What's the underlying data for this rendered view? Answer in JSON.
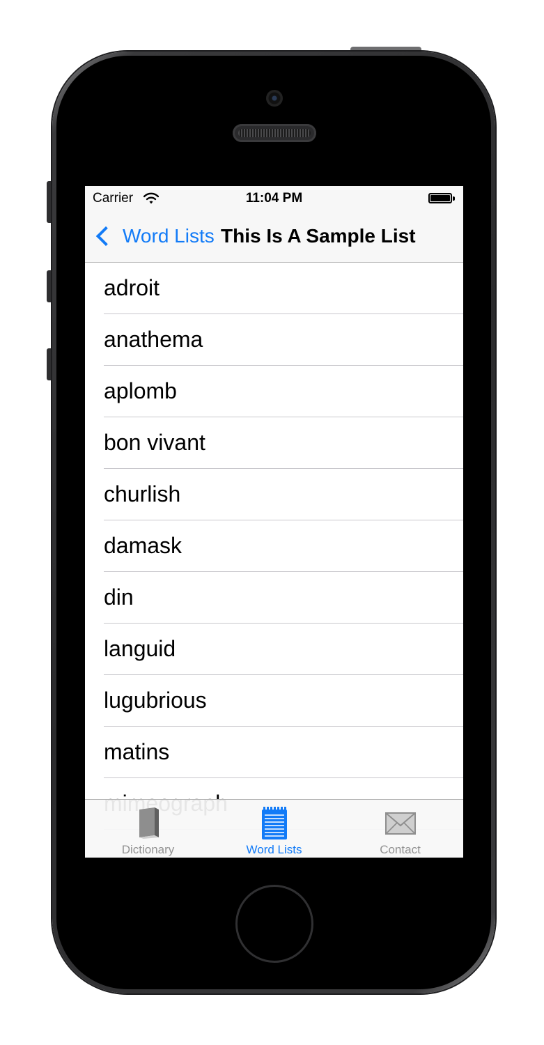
{
  "status_bar": {
    "carrier": "Carrier",
    "time": "11:04 PM"
  },
  "nav": {
    "back_label": "Word Lists",
    "title": "This Is A Sample List"
  },
  "words": [
    "adroit",
    "anathema",
    "aplomb",
    "bon vivant",
    "churlish",
    "damask",
    "din",
    "languid",
    "lugubrious",
    "matins",
    "mimeograph"
  ],
  "tabs": [
    {
      "label": "Dictionary",
      "icon": "book-icon",
      "active": false
    },
    {
      "label": "Word Lists",
      "icon": "notepad-icon",
      "active": true
    },
    {
      "label": "Contact",
      "icon": "envelope-icon",
      "active": false
    }
  ],
  "colors": {
    "accent": "#127bf7",
    "inactive_tab": "#929292",
    "bar_background": "#f7f7f7",
    "separator": "#c8c7cc"
  }
}
